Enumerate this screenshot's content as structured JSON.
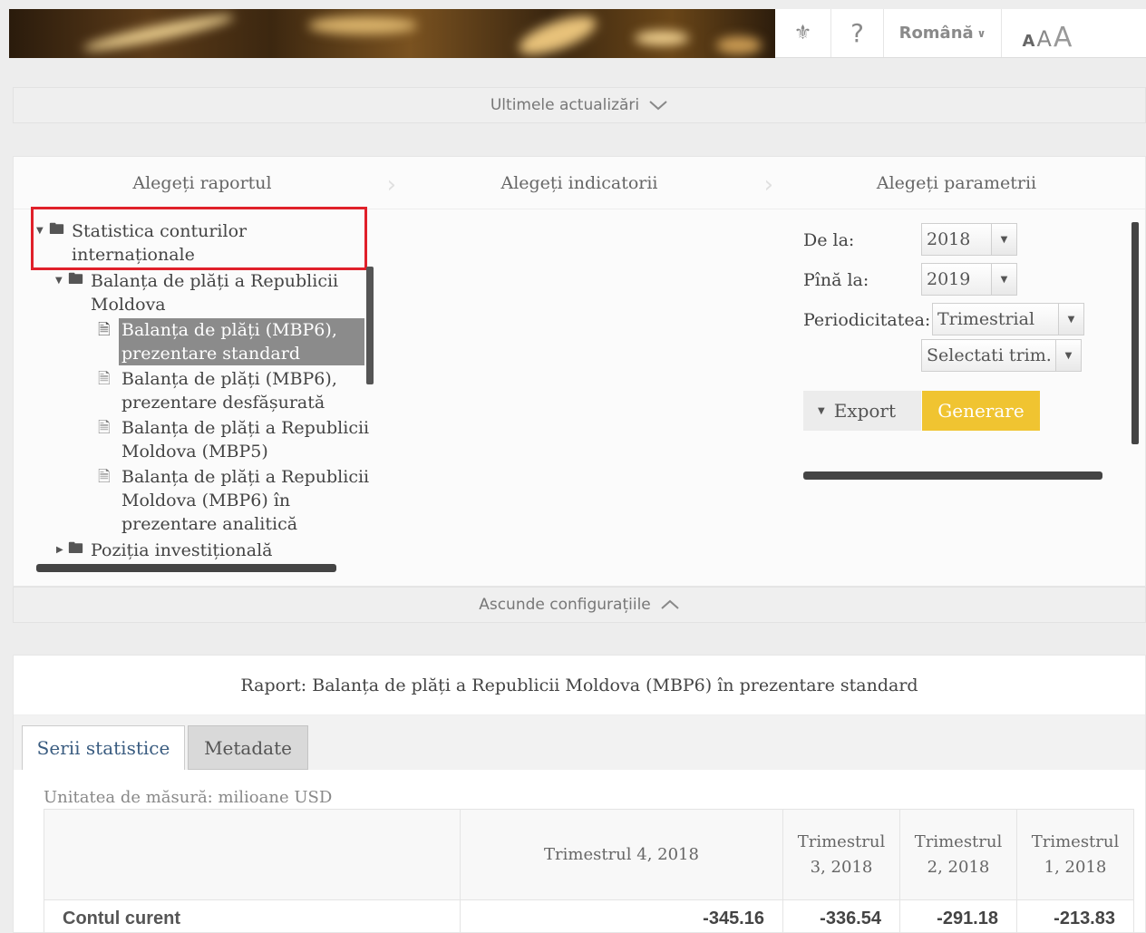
{
  "header": {
    "language": "Română",
    "font_sizes": [
      "A",
      "A",
      "A"
    ],
    "help": "?"
  },
  "updates_bar": {
    "label": "Ultimele actualizări"
  },
  "steps": [
    "Alegeți raportul",
    "Alegeți indicatorii",
    "Alegeți parametrii"
  ],
  "tree": {
    "root": "Statistica conturilor internaționale",
    "root_lines": [
      "Statistica conturilor",
      "internaționale"
    ],
    "group": [
      "Balanța de plăți a Republicii",
      "Moldova"
    ],
    "items": [
      [
        "Balanța de plăți (MBP6),",
        "prezentare standard"
      ],
      [
        "Balanța de plăți (MBP6),",
        "prezentare desfășurată"
      ],
      [
        "Balanța de plăți a Republicii",
        "Moldova (MBP5)"
      ],
      [
        "Balanța de plăți a Republicii",
        "Moldova (MBP6) în",
        "prezentare analitică"
      ]
    ],
    "next_group": "Poziția investițională"
  },
  "params": {
    "from_label": "De la:",
    "from_value": "2018",
    "to_label": "Pînă la:",
    "to_value": "2019",
    "period_label": "Periodicitatea:",
    "period_value": "Trimestrial",
    "quarter_value": "Selectati trim.",
    "export_label": "Export",
    "generate_label": "Generare"
  },
  "hide_bar": {
    "label": "Ascunde configurațiile"
  },
  "report": {
    "title": "Raport: Balanța de plăți a Republicii Moldova (MBP6) în prezentare standard",
    "tabs": [
      "Serii statistice",
      "Metadate"
    ],
    "unit": "Unitatea de măsură: milioane USD",
    "columns": [
      [
        "Trimestrul 4, 2018"
      ],
      [
        "Trimestrul",
        "3, 2018"
      ],
      [
        "Trimestrul",
        "2, 2018"
      ],
      [
        "Trimestrul",
        "1, 2018"
      ]
    ],
    "rows": [
      {
        "label": "Contul curent",
        "values": [
          "-345.16",
          "-336.54",
          "-291.18",
          "-213.83"
        ]
      }
    ]
  },
  "colors": {
    "accent": "#f0c431",
    "highlight": "#e0202a",
    "selected_bg": "#8b8b8b",
    "tab_active_text": "#3a5c80"
  }
}
